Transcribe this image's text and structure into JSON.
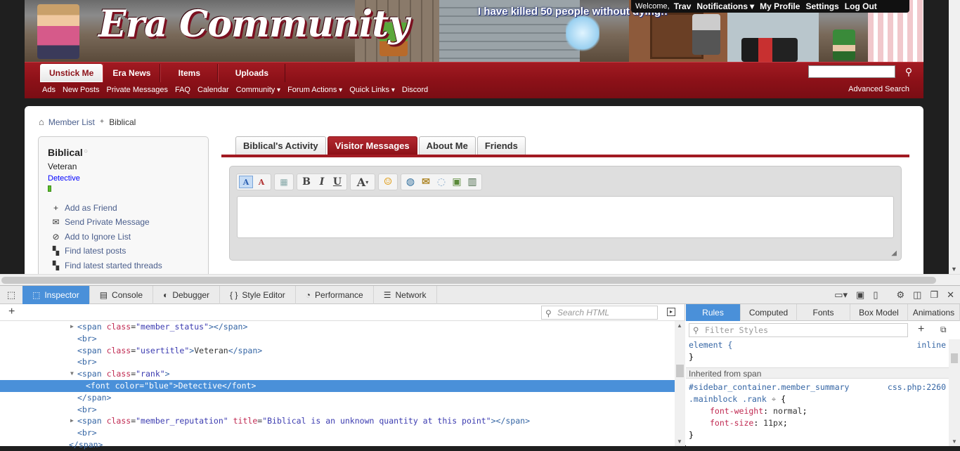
{
  "site": {
    "logo_text": "Era Community",
    "banner_message": "I have killed 50 people without dying!!",
    "userbar": {
      "welcome": "Welcome,",
      "username": "Trav",
      "notifications": "Notifications",
      "my_profile": "My Profile",
      "settings": "Settings",
      "logout": "Log Out"
    },
    "nav_tabs": [
      {
        "label": "Unstick Me"
      },
      {
        "label": "Era News"
      },
      {
        "label": "Items"
      },
      {
        "label": "Uploads"
      }
    ],
    "sub_nav": [
      {
        "label": "Ads",
        "dropdown": false
      },
      {
        "label": "New Posts",
        "dropdown": false
      },
      {
        "label": "Private Messages",
        "dropdown": false
      },
      {
        "label": "FAQ",
        "dropdown": false
      },
      {
        "label": "Calendar",
        "dropdown": false
      },
      {
        "label": "Community",
        "dropdown": true
      },
      {
        "label": "Forum Actions",
        "dropdown": true
      },
      {
        "label": "Quick Links",
        "dropdown": true
      },
      {
        "label": "Discord",
        "dropdown": false
      }
    ],
    "advanced_search": "Advanced Search",
    "breadcrumb": {
      "link": "Member List",
      "current": "Biblical"
    },
    "member": {
      "name": "Biblical",
      "status_icon": "offline-dot",
      "usertitle": "Veteran",
      "rank": "Detective",
      "actions": [
        {
          "label": "Add as Friend",
          "icon": "plus-icon",
          "glyph": "+"
        },
        {
          "label": "Send Private Message",
          "icon": "envelope-icon",
          "glyph": "✉"
        },
        {
          "label": "Add to Ignore List",
          "icon": "ignore-icon",
          "glyph": "⊘"
        },
        {
          "label": "Find latest posts",
          "icon": "posts-icon",
          "glyph": "▚"
        },
        {
          "label": "Find latest started threads",
          "icon": "threads-icon",
          "glyph": "▚"
        }
      ]
    },
    "profile_tabs": [
      {
        "label": "Biblical's Activity"
      },
      {
        "label": "Visitor Messages"
      },
      {
        "label": "About Me"
      },
      {
        "label": "Friends"
      }
    ]
  },
  "devtools": {
    "tabs": [
      {
        "label": "Inspector",
        "icon": "inspector-icon",
        "glyph": "⬚"
      },
      {
        "label": "Console",
        "icon": "console-icon",
        "glyph": "▤"
      },
      {
        "label": "Debugger",
        "icon": "debugger-icon",
        "glyph": "◐"
      },
      {
        "label": "Style Editor",
        "icon": "style-editor-icon",
        "glyph": "{ }"
      },
      {
        "label": "Performance",
        "icon": "performance-icon",
        "glyph": "◔"
      },
      {
        "label": "Network",
        "icon": "network-icon",
        "glyph": "☰"
      }
    ],
    "search_html_placeholder": "Search HTML",
    "filter_styles_placeholder": "Filter Styles",
    "side_tabs": [
      {
        "label": "Rules"
      },
      {
        "label": "Computed"
      },
      {
        "label": "Fonts"
      },
      {
        "label": "Box Model"
      },
      {
        "label": "Animations"
      }
    ],
    "rules": {
      "element_selector": "element {",
      "element_source": "inline",
      "close": "}",
      "inherited_label": "Inherited from span",
      "selector_line1": "#sidebar_container.member_summary",
      "selector_line2": ".mainblock .rank",
      "selector_open": "{",
      "source": "css.php:2260",
      "props": [
        {
          "name": "font-weight",
          "value": "normal"
        },
        {
          "name": "font-size",
          "value": "11px"
        }
      ]
    }
  }
}
